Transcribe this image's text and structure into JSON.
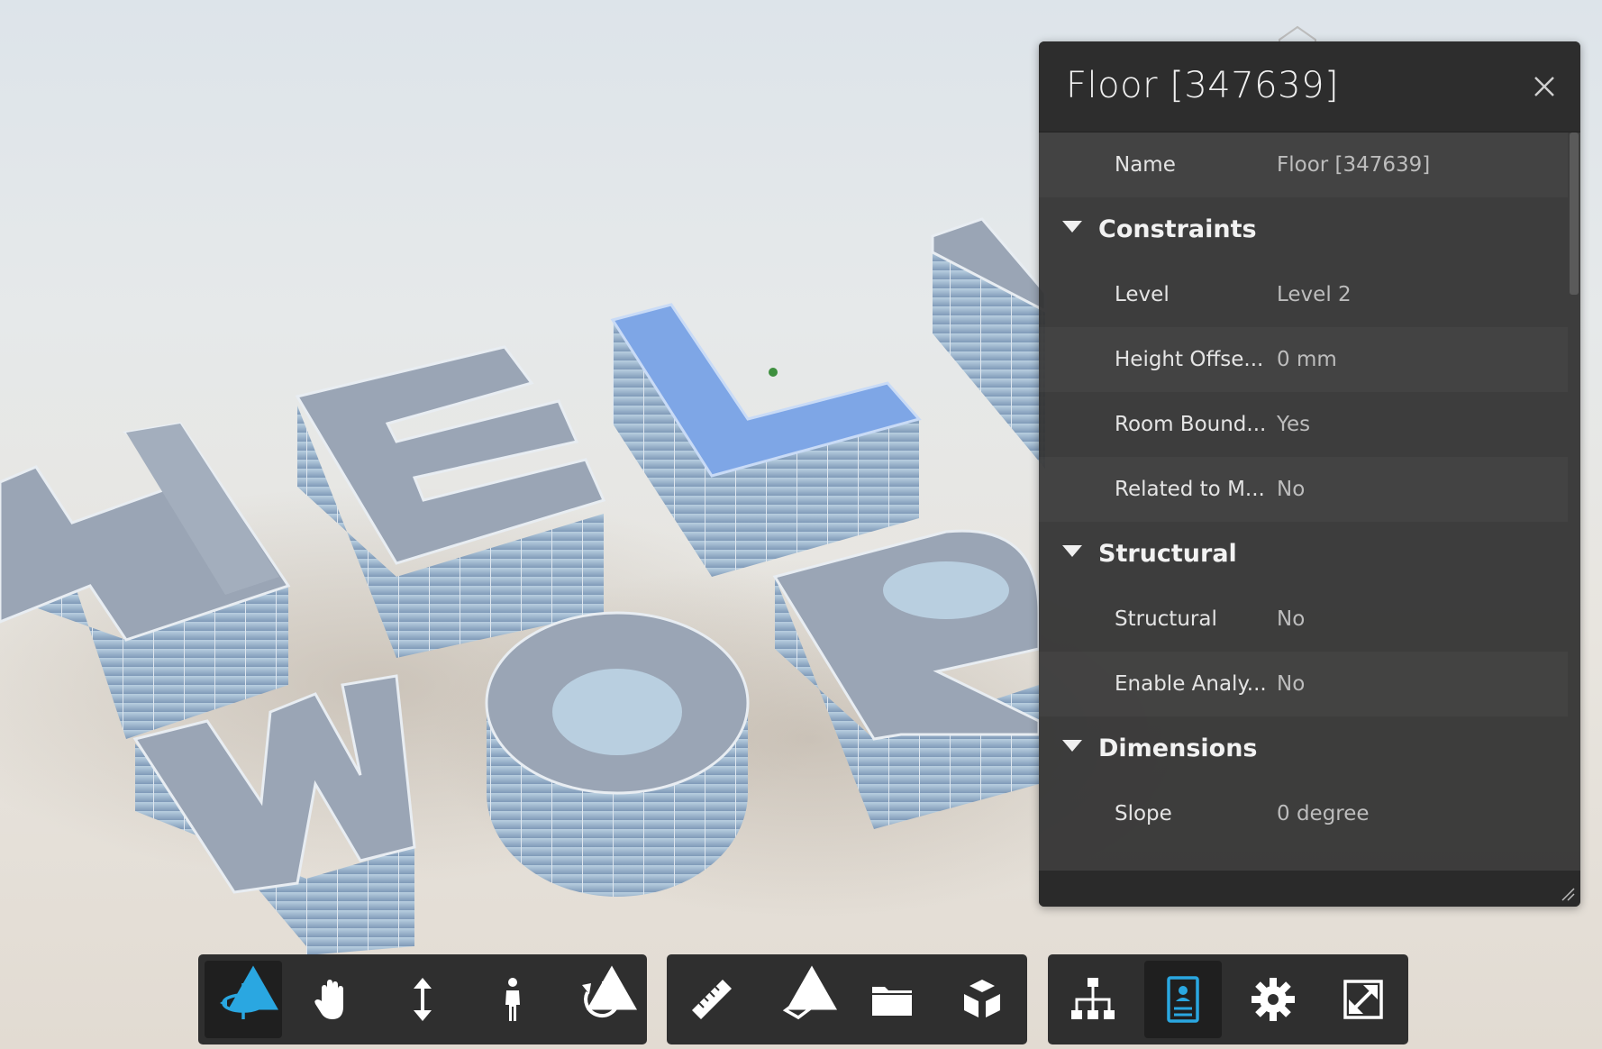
{
  "panel": {
    "title": "Floor [347639]",
    "name_row": {
      "label": "Name",
      "value": "Floor [347639]"
    },
    "categories": [
      {
        "label": "Constraints",
        "rows": [
          {
            "label": "Level",
            "value": "Level 2"
          },
          {
            "label": "Height Offse...",
            "value": "0 mm"
          },
          {
            "label": "Room Bound...",
            "value": "Yes"
          },
          {
            "label": "Related to M...",
            "value": "No"
          }
        ]
      },
      {
        "label": "Structural",
        "rows": [
          {
            "label": "Structural",
            "value": "No"
          },
          {
            "label": "Enable Analy...",
            "value": "No"
          }
        ]
      },
      {
        "label": "Dimensions",
        "rows": [
          {
            "label": "Slope",
            "value": "0 degree"
          }
        ]
      }
    ]
  },
  "toolbar": {
    "navigation": [
      "orbit-icon",
      "pan-icon",
      "zoom-icon",
      "first-person-icon",
      "camera-interactions-icon"
    ],
    "tools": [
      "measure-icon",
      "section-analysis-icon",
      "folder-icon",
      "explode-model-icon"
    ],
    "settings": [
      "model-browser-icon",
      "properties-icon",
      "settings-icon",
      "fullscreen-icon"
    ]
  },
  "colors": {
    "accent": "#2aa7e1",
    "selection": "#7ea6e6",
    "panel_bg": "#323232"
  }
}
